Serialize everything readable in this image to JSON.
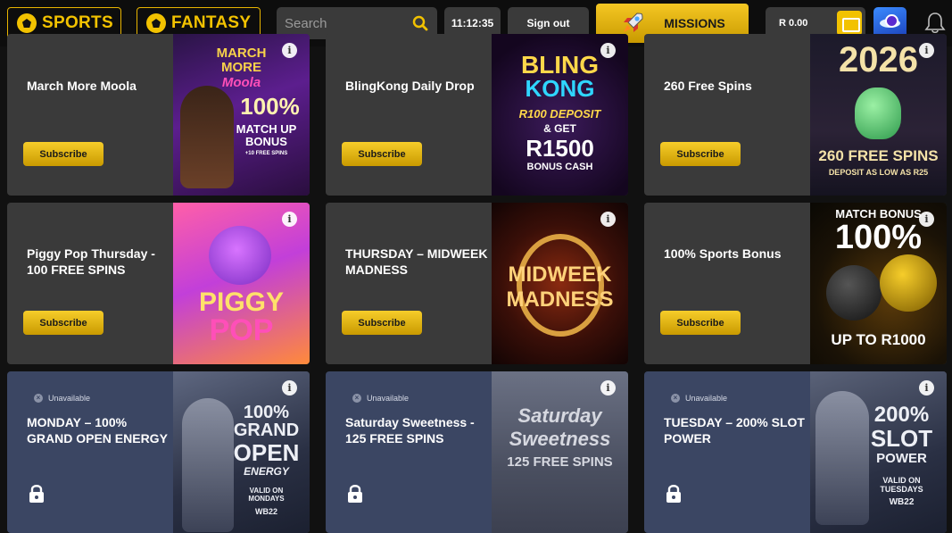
{
  "header": {
    "sports_label": "SPORTS",
    "fantasy_label": "FANTASY",
    "search_placeholder": "Search",
    "clock": "11:12:35",
    "signout_label": "Sign out",
    "missions_label": "MISSIONS",
    "balance": "R 0.00"
  },
  "colors": {
    "accent": "#f2c200",
    "card": "#3a3a3a",
    "unavailable_card": "#3b4663"
  },
  "promos": [
    {
      "title": "March More Moola",
      "button": "Subscribe",
      "art_lines": [
        "MARCH",
        "MORE",
        "Moola",
        "100%",
        "MATCH UP",
        "BONUS",
        "+10 FREE SPINS"
      ]
    },
    {
      "title": "BlingKong Daily Drop",
      "button": "Subscribe",
      "art_lines": [
        "BLING",
        "KONG",
        "R100 DEPOSIT",
        "& GET",
        "R1500",
        "BONUS CASH"
      ]
    },
    {
      "title": "260 Free Spins",
      "button": "Subscribe",
      "art_lines": [
        "2026",
        "260 FREE SPINS",
        "DEPOSIT AS LOW AS R25"
      ]
    },
    {
      "title": "Piggy Pop Thursday - 100 FREE SPINS",
      "button": "Subscribe",
      "art_lines": [
        "PIGGY",
        "POP"
      ]
    },
    {
      "title": "THURSDAY – MIDWEEK MADNESS",
      "button": "Subscribe",
      "art_lines": [
        "MIDWEEK",
        "MADNESS"
      ]
    },
    {
      "title": "100% Sports Bonus",
      "button": "Subscribe",
      "art_lines": [
        "MATCH BONUS",
        "100%",
        "UP TO R1000"
      ]
    },
    {
      "title": "MONDAY – 100% GRAND OPEN ENERGY",
      "status": "Unavailable",
      "art_lines": [
        "100%",
        "GRAND",
        "OPEN",
        "ENERGY",
        "VALID ON",
        "MONDAYS",
        "WB22"
      ]
    },
    {
      "title": "Saturday Sweetness - 125 FREE SPINS",
      "status": "Unavailable",
      "art_lines": [
        "Saturday",
        "Sweetness",
        "125 FREE SPINS"
      ]
    },
    {
      "title": "TUESDAY – 200% SLOT POWER",
      "status": "Unavailable",
      "art_lines": [
        "200%",
        "SLOT",
        "POWER",
        "VALID ON",
        "TUESDAYS",
        "WB22"
      ]
    }
  ]
}
